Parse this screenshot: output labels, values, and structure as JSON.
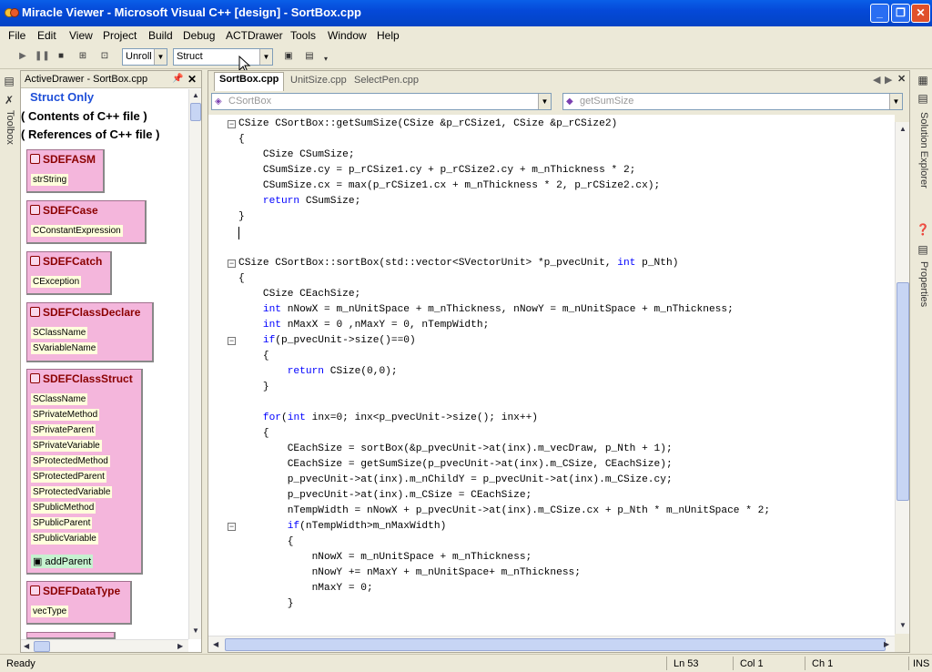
{
  "window": {
    "title": "Miracle Viewer - Microsoft Visual C++ [design] - SortBox.cpp"
  },
  "menu": [
    "File",
    "Edit",
    "View",
    "Project",
    "Build",
    "Debug",
    "ACTDrawer",
    "Tools",
    "Window",
    "Help"
  ],
  "toolbar": {
    "unroll_label": "Unroll",
    "struct_value": "Struct"
  },
  "left_tabs": {
    "toolbox": "Toolbox"
  },
  "drawer": {
    "title": "ActiveDrawer - SortBox.cpp",
    "links": [
      "Struct Only",
      "( Contents of C++ file )",
      "( References of C++ file )"
    ],
    "structs": [
      {
        "name": "SDEFASM",
        "fields": [
          "strString"
        ],
        "methods": []
      },
      {
        "name": "SDEFCase",
        "fields": [
          "CConstantExpression"
        ],
        "methods": []
      },
      {
        "name": "SDEFCatch",
        "fields": [
          "CException"
        ],
        "methods": []
      },
      {
        "name": "SDEFClassDeclare",
        "fields": [
          "SClassName",
          "SVariableName"
        ],
        "methods": []
      },
      {
        "name": "SDEFClassStruct",
        "fields": [
          "SClassName",
          "SPrivateMethod",
          "SPrivateParent",
          "SPrivateVariable",
          "SProtectedMethod",
          "SProtectedParent",
          "SProtectedVariable",
          "SPublicMethod",
          "SPublicParent",
          "SPublicVariable"
        ],
        "methods": [
          "addParent"
        ]
      },
      {
        "name": "SDEFDataType",
        "fields": [
          "vecType"
        ],
        "methods": []
      }
    ]
  },
  "editor": {
    "tabs": [
      "SortBox.cpp",
      "UnitSize.cpp",
      "SelectPen.cpp"
    ],
    "class_combo": "CSortBox",
    "method_combo": "getSumSize",
    "lines": [
      "CSize CSortBox::getSumSize(CSize &p_rCSize1, CSize &p_rCSize2)",
      "{",
      "    CSize CSumSize;",
      "    CSumSize.cy = p_rCSize1.cy + p_rCSize2.cy + m_nThickness * 2;",
      "    CSumSize.cx = max(p_rCSize1.cx + m_nThickness * 2, p_rCSize2.cx);",
      "    return CSumSize;",
      "}",
      "",
      "",
      "CSize CSortBox::sortBox(std::vector<SVectorUnit> *p_pvecUnit, int p_Nth)",
      "{",
      "    CSize CEachSize;",
      "    int nNowX = m_nUnitSpace + m_nThickness, nNowY = m_nUnitSpace + m_nThickness;",
      "    int nMaxX = 0 ,nMaxY = 0, nTempWidth;",
      "    if(p_pvecUnit->size()==0)",
      "    {",
      "        return CSize(0,0);",
      "    }",
      "",
      "    for(int inx=0; inx<p_pvecUnit->size(); inx++)",
      "    {",
      "        CEachSize = sortBox(&p_pvecUnit->at(inx).m_vecDraw, p_Nth + 1);",
      "        CEachSize = getSumSize(p_pvecUnit->at(inx).m_CSize, CEachSize);",
      "        p_pvecUnit->at(inx).m_nChildY = p_pvecUnit->at(inx).m_CSize.cy;",
      "        p_pvecUnit->at(inx).m_CSize = CEachSize;",
      "        nTempWidth = nNowX + p_pvecUnit->at(inx).m_CSize.cx + p_Nth * m_nUnitSpace * 2;",
      "        if(nTempWidth>m_nMaxWidth)",
      "        {",
      "            nNowX = m_nUnitSpace + m_nThickness;",
      "            nNowY += nMaxY + m_nUnitSpace+ m_nThickness;",
      "            nMaxY = 0;",
      "        }"
    ]
  },
  "right_tabs": {
    "solution_explorer": "Solution Explorer",
    "properties": "Properties"
  },
  "status": {
    "ready": "Ready",
    "line": "Ln 53",
    "col": "Col 1",
    "ch": "Ch 1",
    "mode": "INS"
  }
}
